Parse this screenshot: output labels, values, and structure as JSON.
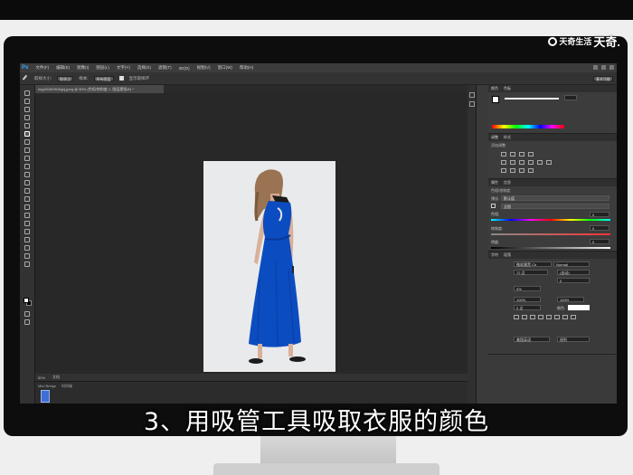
{
  "watermark": {
    "icon": "search-circle-icon",
    "text": "天奇生活",
    "text_big": "天奇."
  },
  "app": {
    "logo": "Ps",
    "menu": [
      "文件(F)",
      "编辑(E)",
      "图像(I)",
      "图层(L)",
      "文字(Y)",
      "选择(S)",
      "滤镜(T)",
      "3D(D)",
      "视图(V)",
      "窗口(W)",
      "帮助(H)"
    ],
    "options_bar": {
      "sample_size_label": "取样大小:",
      "sample_size_value": "取样点",
      "sample_label": "样本:",
      "sample_value": "所有图层",
      "show_ring_label": "显示取样环",
      "workspace": "基本功能"
    },
    "document_tab": "img20180910sjnj.jpeg @ 50% (色相/饱和度 1, 图层蒙版/8) *",
    "status": {
      "zoom": "50%",
      "doc_label": "文档",
      "mini_bridge": "Mini Bridge",
      "timeline": "时间轴"
    },
    "panels": {
      "color_tabs": [
        "颜色",
        "色板"
      ],
      "adjust_tabs": [
        "调整",
        "样式"
      ],
      "adjust_title": "添加调整",
      "properties_tabs": [
        "属性",
        "信息"
      ],
      "properties_title": "色相/饱和度",
      "preset_label": "预设:",
      "preset_value": "默认值",
      "channel_value": "全图",
      "hue_label": "色相:",
      "hue_value": "0",
      "saturation_label": "饱和度:",
      "saturation_value": "0",
      "lightness_label": "明度:",
      "lightness_value": "0",
      "char_tabs": [
        "字符",
        "段落"
      ],
      "font_value": "微软雅黑 Ch",
      "style_value": "Normal",
      "size_value": "72 点",
      "leading_value": "(自动)",
      "tracking_value": "0",
      "scale_value": "0%",
      "vscale_value": "100%",
      "hscale_value": "100%",
      "baseline_value": "0 点",
      "color_label": "颜色:",
      "lang_value": "美国英语",
      "aa_value": "锐利"
    }
  },
  "subtitle": "3、用吸管工具吸取衣服的颜色",
  "colors": {
    "dress": "#0a4bbf",
    "hair": "#8a6a4a",
    "skin": "#d9b09a",
    "ps_blue": "#31a8ff"
  }
}
